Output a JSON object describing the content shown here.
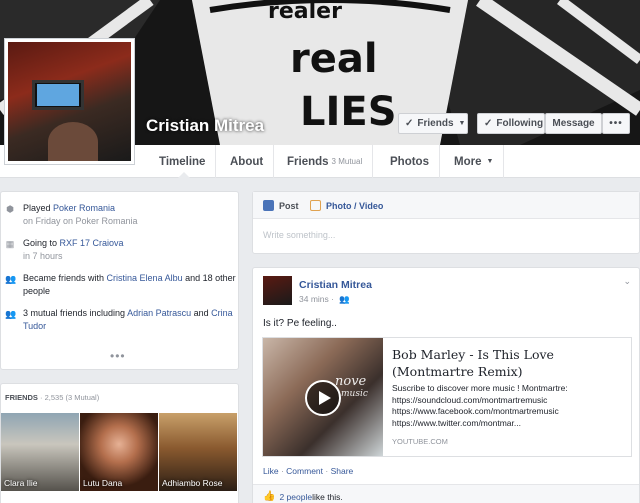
{
  "profile": {
    "name": "Cristian Mitrea",
    "buttons": {
      "friends": "Friends",
      "following": "Following",
      "message": "Message",
      "more": "•••"
    }
  },
  "nav": {
    "timeline": "Timeline",
    "about": "About",
    "friends": "Friends",
    "friends_mutual": "3 Mutual",
    "photos": "Photos",
    "more": "More"
  },
  "activity": [
    {
      "text_pre": "Played ",
      "link": "Poker Romania",
      "text_post": "",
      "meta": "on Friday on Poker Romania"
    },
    {
      "text_pre": "Going to ",
      "link": "RXF 17 Craiova",
      "text_post": "",
      "meta": "in 7 hours"
    },
    {
      "text_pre": "Became friends with ",
      "link": "Cristina Elena Albu",
      "text_post": " and 18 other people",
      "meta": ""
    },
    {
      "text_pre": "3 mutual friends including ",
      "link": "Adrian Patrascu",
      "text_post": " and ",
      "link2": "Crina Tudor",
      "meta": ""
    }
  ],
  "friends_panel": {
    "title": "FRIENDS",
    "count": "· 2,535 (3 Mutual)",
    "tiles": [
      {
        "name": "Clara Ilie"
      },
      {
        "name": "Lutu Dana"
      },
      {
        "name": "Adhiambo Rose"
      }
    ]
  },
  "composer": {
    "tab_post": "Post",
    "tab_photo": "Photo / Video",
    "placeholder": "Write something..."
  },
  "post": {
    "author": "Cristian Mitrea",
    "time": "34 mins ·",
    "text": "Is it? Pe feeling..",
    "link_card": {
      "title": "Bob Marley - Is This Love (Montmartre Remix)",
      "desc_line1": "Suscribe to discover more music ! Montmartre:",
      "desc_line2": "https://soundcloud.com/montmartremusic",
      "desc_line3": "https://www.facebook.com/montmartremusic",
      "desc_line4": "https://www.twitter.com/montmar...",
      "domain": "YOUTUBE.COM",
      "thumb_watermark": "nove",
      "thumb_watermark_sub": "music"
    },
    "actions": {
      "like": "Like",
      "comment": "Comment",
      "share": "Share"
    },
    "likes_count": "2 people",
    "likes_suffix": " like this."
  }
}
